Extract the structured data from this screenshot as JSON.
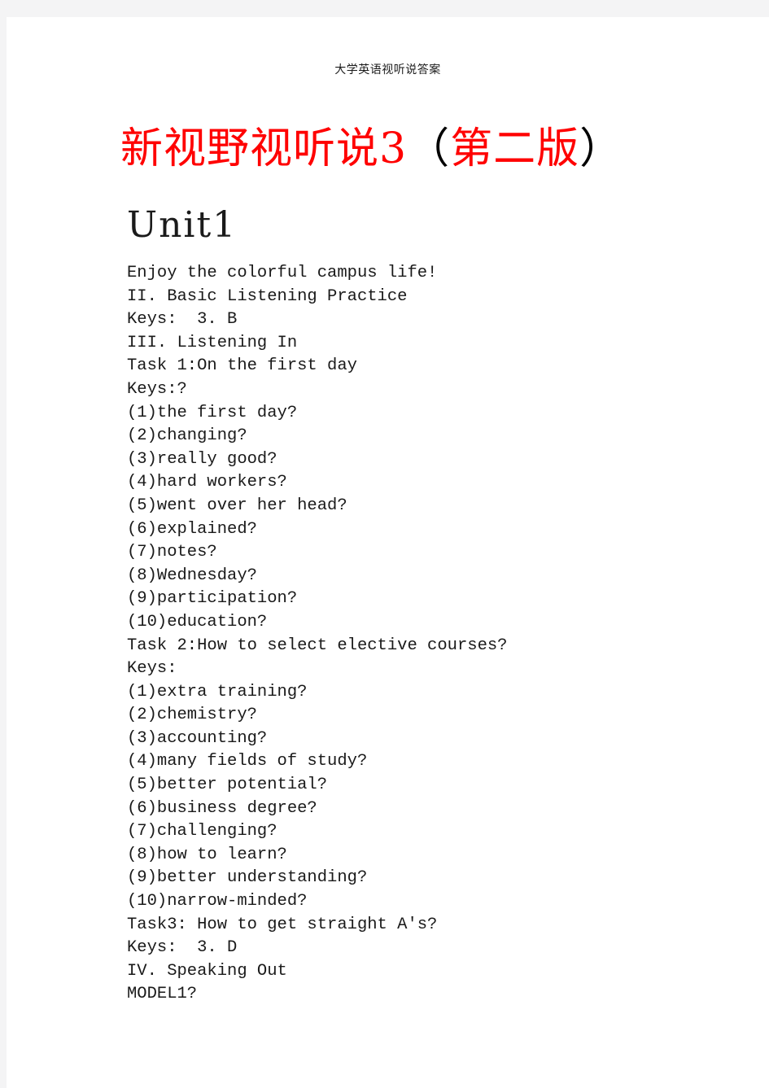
{
  "page": {
    "background_color": "#f4f4f5",
    "sheet_color": "#ffffff",
    "running_header": "大学英语视听说答案"
  },
  "title": {
    "main_red": "新视野视听说3",
    "paren_open": "（",
    "edition_red": "第二版",
    "paren_close": "）",
    "color_red": "#ff0000",
    "color_black": "#000000"
  },
  "unit": {
    "heading": "Unit1"
  },
  "body": {
    "lines": [
      "Enjoy the colorful campus life!",
      "II. Basic Listening Practice",
      "Keys:  3. B",
      "III. Listening In",
      "Task 1:On the first day",
      "Keys:?",
      "(1)the first day?",
      "(2)changing?",
      "(3)really good?",
      "(4)hard workers?",
      "(5)went over her head?",
      "(6)explained?",
      "(7)notes?",
      "(8)Wednesday?",
      "(9)participation?",
      "(10)education?",
      "Task 2:How to select elective courses?",
      "Keys:",
      "(1)extra training?",
      "(2)chemistry?",
      "(3)accounting?",
      "(4)many fields of study?",
      "(5)better potential?",
      "(6)business degree?",
      "(7)challenging?",
      "(8)how to learn?",
      "(9)better understanding?",
      "(10)narrow-minded?",
      "Task3: How to get straight A's?",
      "Keys:  3. D",
      "IV. Speaking Out",
      "MODEL1?"
    ]
  }
}
